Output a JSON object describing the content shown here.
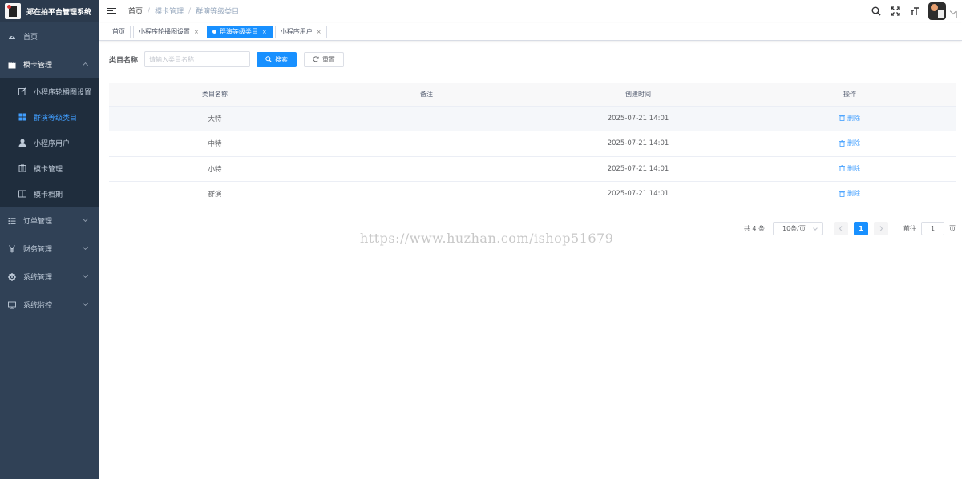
{
  "app": {
    "title": "郑在拍平台管理系统"
  },
  "sidebar": {
    "items": [
      {
        "label": "首页",
        "icon": "dashboard-icon"
      },
      {
        "label": "模卡管理",
        "icon": "clapperboard-icon",
        "expanded": true,
        "children": [
          {
            "label": "小程序轮播图设置",
            "icon": "edit-icon"
          },
          {
            "label": "群演等级类目",
            "icon": "grid-icon",
            "active": true
          },
          {
            "label": "小程序用户",
            "icon": "user-icon"
          },
          {
            "label": "模卡管理",
            "icon": "clipboard-icon"
          },
          {
            "label": "模卡档期",
            "icon": "book-icon"
          }
        ]
      },
      {
        "label": "订单管理",
        "icon": "list-icon"
      },
      {
        "label": "财务管理",
        "icon": "yen-icon"
      },
      {
        "label": "系统管理",
        "icon": "gear-icon"
      },
      {
        "label": "系统监控",
        "icon": "monitor-icon"
      }
    ],
    "colors": {
      "bg": "#304156",
      "active": "#409eff"
    }
  },
  "breadcrumb": [
    "首页",
    "模卡管理",
    "群演等级类目"
  ],
  "tags": [
    {
      "label": "首页"
    },
    {
      "label": "小程序轮播图设置"
    },
    {
      "label": "群演等级类目",
      "active": true
    },
    {
      "label": "小程序用户"
    }
  ],
  "search": {
    "label": "类目名称",
    "placeholder": "请输入类目名称",
    "value": "",
    "search_label": "搜索",
    "reset_label": "重置"
  },
  "table": {
    "headers": [
      "类目名称",
      "备注",
      "创建时间",
      "操作"
    ],
    "rows": [
      {
        "name": "大特",
        "remark": "",
        "created": "2025-07-21 14:01",
        "action": "删除"
      },
      {
        "name": "中特",
        "remark": "",
        "created": "2025-07-21 14:01",
        "action": "删除"
      },
      {
        "name": "小特",
        "remark": "",
        "created": "2025-07-21 14:01",
        "action": "删除"
      },
      {
        "name": "群演",
        "remark": "",
        "created": "2025-07-21 14:01",
        "action": "删除"
      }
    ]
  },
  "pagination": {
    "total_text": "共 4 条",
    "page_size": "10条/页",
    "current_page": "1",
    "goto_prefix": "前往",
    "goto_value": "1",
    "goto_suffix": "页"
  },
  "watermark": "https://www.huzhan.com/ishop51679",
  "accent": "#1890ff"
}
